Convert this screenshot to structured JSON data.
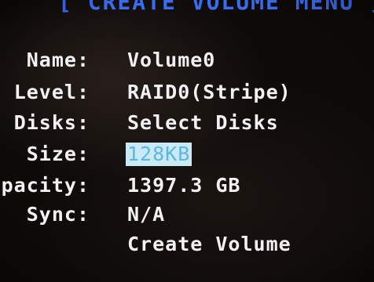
{
  "header": {
    "title": "[ CREATE VOLUME MENU ]"
  },
  "fields": [
    {
      "label": "Name:",
      "value": "Volume0"
    },
    {
      "label": "Level:",
      "value": "RAID0(Stripe)"
    },
    {
      "label": "Disks:",
      "value": "Select Disks"
    },
    {
      "label": "Size:",
      "value": "128KB"
    },
    {
      "label": "Capacity:",
      "value": "1397.3 GB"
    },
    {
      "label": "Sync:",
      "value": "N/A"
    }
  ],
  "action": {
    "label": "Create Volume"
  },
  "colors": {
    "background": "#0d0a09",
    "text": "#f3f1f4",
    "header": "#3b6cf0",
    "highlight_bg": "#c9eaf4",
    "highlight_text": "#5fb5de"
  }
}
